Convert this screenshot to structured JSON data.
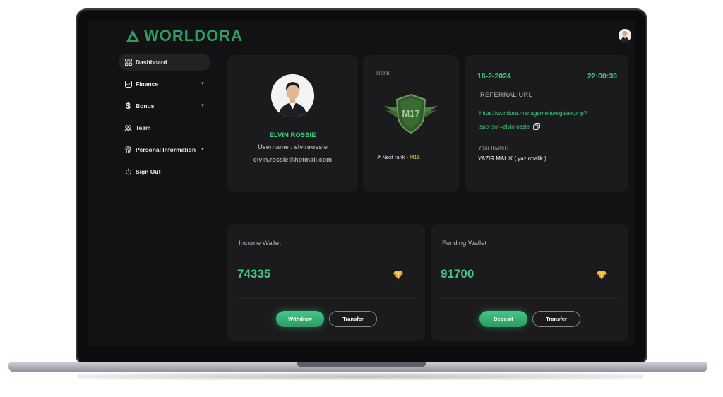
{
  "app": {
    "logo_text": "WORLDORA"
  },
  "sidebar": {
    "items": [
      {
        "label": "Dashboard",
        "icon": "grid-icon"
      },
      {
        "label": "Finance",
        "icon": "check-square-icon"
      },
      {
        "label": "Bonus",
        "icon": "dollar-icon"
      },
      {
        "label": "Team",
        "icon": "users-icon"
      },
      {
        "label": "Personal Information",
        "icon": "fingerprint-icon"
      },
      {
        "label": "Sign Out",
        "icon": "power-icon"
      }
    ]
  },
  "profile": {
    "name": "ELVIN ROSSIE",
    "username": "Username : elvinrossie",
    "email": "elvin.rossie@hotmail.com"
  },
  "rank": {
    "label": "Rank",
    "current": "M17",
    "next_prefix": "Next rank - ",
    "next_value": "M18"
  },
  "referral": {
    "date": "16-2-2024",
    "time": "22:00:39",
    "title": "REFERRAL URL",
    "url_line1": "https://worldora.management/register.php?",
    "url_line2": "sponsor=elvinrossie",
    "inviter_label": "Your Inviter:",
    "inviter_name": "YAZIR MALIK ( yazirmalik )"
  },
  "income_wallet": {
    "title": "Income Wallet",
    "amount": "74335",
    "primary_button": "Withdraw",
    "secondary_button": "Transfer"
  },
  "funding_wallet": {
    "title": "Funding Wallet",
    "amount": "91700",
    "primary_button": "Deposit",
    "secondary_button": "Transfer"
  },
  "colors": {
    "accent": "#3ccb7f",
    "rank_next": "#e8b93a",
    "background": "#121214",
    "card": "#1b1b1d"
  }
}
